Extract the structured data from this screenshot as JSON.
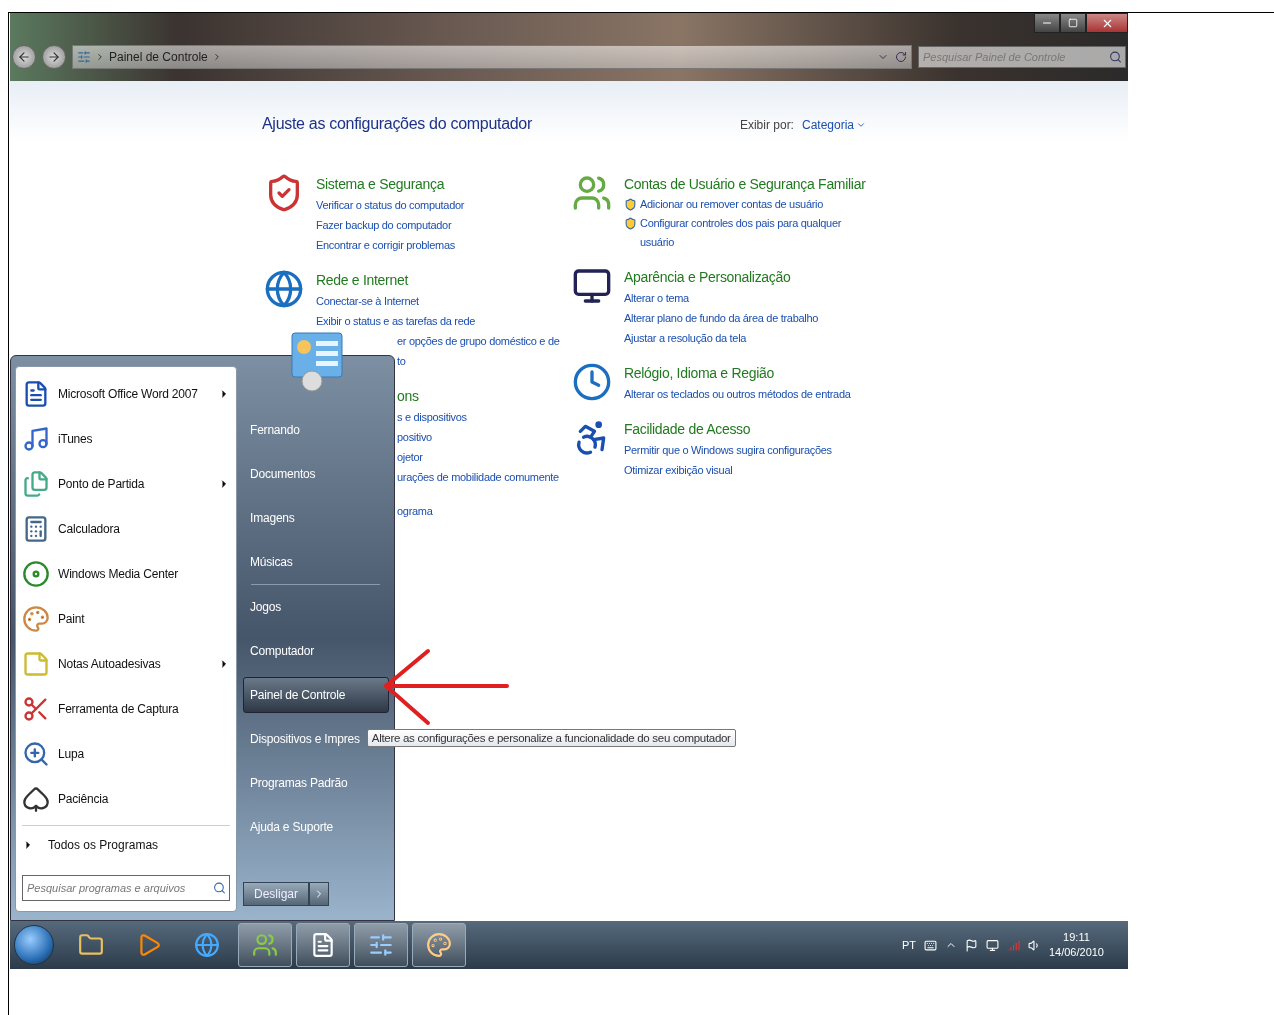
{
  "window": {
    "breadcrumb": "Painel de Controle",
    "search_placeholder": "Pesquisar Painel de Controle"
  },
  "control_panel": {
    "heading": "Ajuste as configurações do computador",
    "view_by_label": "Exibir por:",
    "view_by_value": "Categoria",
    "columns": [
      [
        {
          "title": "Sistema e Segurança",
          "covered": false,
          "links": [
            {
              "text": "Verificar o status do computador",
              "covered": false,
              "shield": false
            },
            {
              "text": "Fazer backup do computador",
              "covered": false,
              "shield": false
            },
            {
              "text": "Encontrar e corrigir problemas",
              "covered": false,
              "shield": false
            }
          ]
        },
        {
          "title": "Rede e Internet",
          "covered": false,
          "links": [
            {
              "text": "Conectar-se à Internet",
              "covered": false,
              "shield": false
            },
            {
              "text": "Exibir o status e as tarefas da rede",
              "covered": false,
              "shield": false
            },
            {
              "text": "er opções de grupo doméstico e de",
              "covered": true,
              "shield": false
            },
            {
              "text": "to",
              "covered": true,
              "shield": false
            }
          ]
        },
        {
          "title": "ons",
          "covered": true,
          "links": [
            {
              "text": "s e dispositivos",
              "covered": true,
              "shield": false
            },
            {
              "text": "positivo",
              "covered": true,
              "shield": false
            },
            {
              "text": "ojetor",
              "covered": true,
              "shield": false
            },
            {
              "text": "urações de mobilidade comumente",
              "covered": true,
              "shield": false
            }
          ]
        },
        {
          "covered": true,
          "links": [
            {
              "text": "ograma",
              "covered": true,
              "shield": false
            }
          ]
        }
      ],
      [
        {
          "title": "Contas de Usuário e Segurança Familiar",
          "covered": false,
          "links": [
            {
              "text": "Adicionar ou remover contas de usuário",
              "covered": false,
              "shield": true
            },
            {
              "text": "Configurar controles dos pais para qualquer usuário",
              "covered": false,
              "shield": true
            }
          ]
        },
        {
          "title": "Aparência e Personalização",
          "covered": false,
          "links": [
            {
              "text": "Alterar o tema",
              "covered": false,
              "shield": false
            },
            {
              "text": "Alterar plano de fundo da área de trabalho",
              "covered": false,
              "shield": false
            },
            {
              "text": "Ajustar a resolução da tela",
              "covered": false,
              "shield": false
            }
          ]
        },
        {
          "title": "Relógio, Idioma e Região",
          "covered": false,
          "links": [
            {
              "text": "Alterar os teclados ou outros métodos de entrada",
              "covered": false,
              "shield": false
            }
          ]
        },
        {
          "title": "Facilidade de Acesso",
          "covered": false,
          "links": [
            {
              "text": "Permitir que o Windows sugira configurações",
              "covered": false,
              "shield": false
            },
            {
              "text": "Otimizar exibição visual",
              "covered": false,
              "shield": false
            }
          ]
        }
      ]
    ]
  },
  "start_menu": {
    "programs": [
      {
        "label": "Microsoft Office Word 2007",
        "submenu": true
      },
      {
        "label": "iTunes",
        "submenu": false
      },
      {
        "label": "Ponto de Partida",
        "submenu": true
      },
      {
        "label": "Calculadora",
        "submenu": false
      },
      {
        "label": "Windows Media Center",
        "submenu": false
      },
      {
        "label": "Paint",
        "submenu": false
      },
      {
        "label": "Notas Autoadesivas",
        "submenu": true
      },
      {
        "label": "Ferramenta de Captura",
        "submenu": false
      },
      {
        "label": "Lupa",
        "submenu": false
      },
      {
        "label": "Paciência",
        "submenu": false
      }
    ],
    "all_programs": "Todos os Programas",
    "search_placeholder": "Pesquisar programas e arquivos",
    "place_groups": [
      [
        {
          "label": "Fernando",
          "selected": false
        },
        {
          "label": "Documentos",
          "selected": false
        },
        {
          "label": "Imagens",
          "selected": false
        },
        {
          "label": "Músicas",
          "selected": false
        }
      ],
      [
        {
          "label": "Jogos",
          "selected": false
        },
        {
          "label": "Computador",
          "selected": false
        },
        {
          "label": "Painel de Controle",
          "selected": true,
          "tooltip": "Altere as configurações e personalize a funcionalidade do seu computador"
        },
        {
          "label": "Dispositivos e Impres",
          "selected": false
        },
        {
          "label": "Programas Padrão",
          "selected": false
        },
        {
          "label": "Ajuda e Suporte",
          "selected": false
        }
      ]
    ],
    "shutdown": "Desligar"
  },
  "taskbar": {
    "items": [
      {
        "running": false
      },
      {
        "running": false
      },
      {
        "running": false
      },
      {
        "running": true
      },
      {
        "running": true
      },
      {
        "running": true
      },
      {
        "running": true
      }
    ],
    "tray": {
      "language": "PT",
      "time": "19:11",
      "date": "14/06/2010"
    }
  }
}
